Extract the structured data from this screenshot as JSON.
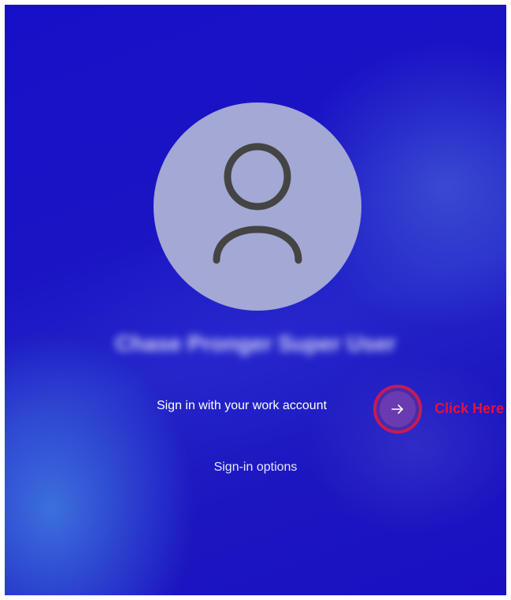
{
  "user": {
    "name": "Chase Pronger Super User"
  },
  "signin": {
    "work_account_label": "Sign in with your work account",
    "options_label": "Sign-in options",
    "submit_icon": "arrow-right-icon"
  },
  "annotation": {
    "text": "Click Here",
    "color": "#e8103a"
  },
  "colors": {
    "background": "#1a14c4",
    "avatar_bg": "#a4a8d4",
    "avatar_icon": "#444444",
    "highlight_ring": "#c81a54"
  }
}
